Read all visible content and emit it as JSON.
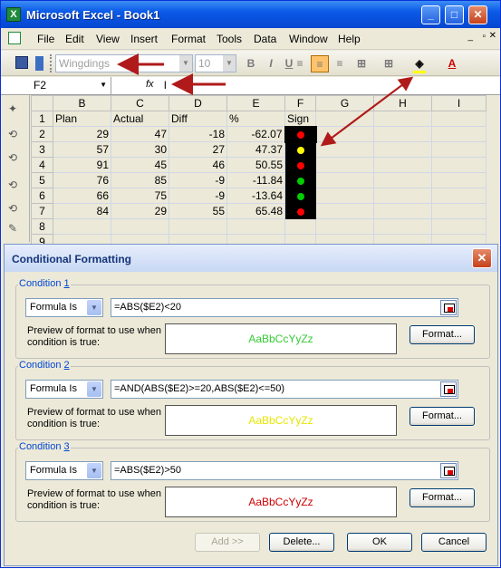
{
  "window": {
    "title": "Microsoft Excel - Book1",
    "app_icon": "excel-icon",
    "controls": [
      "minimize-icon",
      "maximize-icon",
      "close-icon"
    ]
  },
  "menu": {
    "items": [
      "File",
      "Edit",
      "View",
      "Insert",
      "Format",
      "Tools",
      "Data",
      "Window",
      "Help"
    ]
  },
  "toolbar": {
    "font_name": "Wingdings",
    "font_size": "10",
    "bold": "B",
    "italic": "I",
    "underline": "U",
    "font_color_letter": "A"
  },
  "formula_bar": {
    "name_box": "F2",
    "fx": "fx",
    "content": "l"
  },
  "sheet": {
    "columns": [
      "B",
      "C",
      "D",
      "E",
      "F",
      "G",
      "H",
      "I"
    ],
    "rows": [
      {
        "n": "1",
        "cells": [
          "Plan",
          "Actual",
          "Diff",
          "%",
          "Sign",
          "",
          "",
          ""
        ]
      },
      {
        "n": "2",
        "cells": [
          "29",
          "47",
          "-18",
          "-62.07",
          "l",
          "",
          "",
          ""
        ],
        "sign": "red"
      },
      {
        "n": "3",
        "cells": [
          "57",
          "30",
          "27",
          "47.37",
          "l",
          "",
          "",
          ""
        ],
        "sign": "yellow"
      },
      {
        "n": "4",
        "cells": [
          "91",
          "45",
          "46",
          "50.55",
          "l",
          "",
          "",
          ""
        ],
        "sign": "red"
      },
      {
        "n": "5",
        "cells": [
          "76",
          "85",
          "-9",
          "-11.84",
          "l",
          "",
          "",
          ""
        ],
        "sign": "green"
      },
      {
        "n": "6",
        "cells": [
          "66",
          "75",
          "-9",
          "-13.64",
          "l",
          "",
          "",
          ""
        ],
        "sign": "green"
      },
      {
        "n": "7",
        "cells": [
          "84",
          "29",
          "55",
          "65.48",
          "l",
          "",
          "",
          ""
        ],
        "sign": "red"
      },
      {
        "n": "8",
        "cells": [
          "",
          "",
          "",
          "",
          "",
          "",
          "",
          ""
        ]
      },
      {
        "n": "9",
        "cells": [
          "",
          "",
          "",
          "",
          "",
          "",
          "",
          ""
        ]
      }
    ],
    "sign_colors": {
      "red": "#ff0000",
      "yellow": "#ffff00",
      "green": "#00cc00"
    }
  },
  "dialog": {
    "title": "Conditional Formatting",
    "conditions": [
      {
        "label": "Condition",
        "num": "1",
        "type": "Formula Is",
        "formula": "=ABS($E2)<20",
        "preview": "AaBbCcYyZz",
        "preview_color": "#33cc33"
      },
      {
        "label": "Condition",
        "num": "2",
        "type": "Formula Is",
        "formula": "=AND(ABS($E2)>=20,ABS($E2)<=50)",
        "preview": "AaBbCcYyZz",
        "preview_color": "#e6e600"
      },
      {
        "label": "Condition",
        "num": "3",
        "type": "Formula Is",
        "formula": "=ABS($E2)>50",
        "preview": "AaBbCcYyZz",
        "preview_color": "#cc0000"
      }
    ],
    "preview_label": "Preview of format to use when condition is true:",
    "format_button": "Format...",
    "add_button": "Add >>",
    "delete_button": "Delete...",
    "ok_button": "OK",
    "cancel_button": "Cancel"
  }
}
